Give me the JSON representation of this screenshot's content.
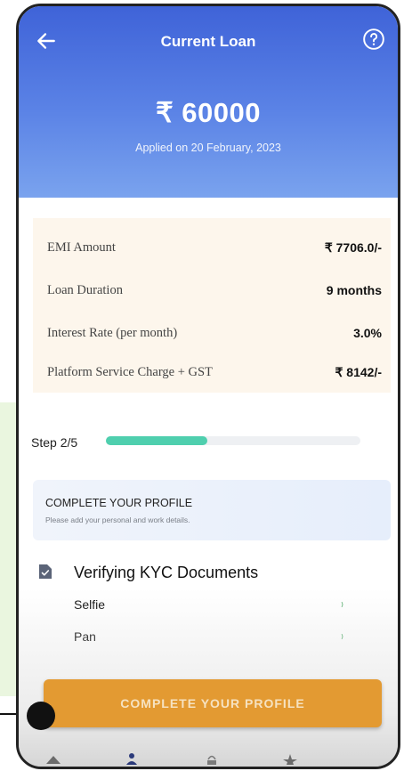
{
  "header": {
    "title": "Current Loan",
    "amount": "₹ 60000",
    "applied_on": "Applied on 20 February, 2023"
  },
  "details": [
    {
      "label": "EMI Amount",
      "value": "₹ 7706.0/-"
    },
    {
      "label": "Loan Duration",
      "value": "9 months"
    },
    {
      "label": "Interest Rate (per month)",
      "value": "3.0%"
    },
    {
      "label": "Platform Service Charge + GST",
      "value": "₹ 8142/-"
    }
  ],
  "progress": {
    "label": "Step 2/5",
    "fraction": 0.4
  },
  "profile_card": {
    "title": "COMPLETE YOUR PROFILE",
    "subtitle": "Please add your personal and work details."
  },
  "kyc": {
    "title": "Verifying KYC Documents",
    "items": [
      {
        "label": "Selfie",
        "status": "⁾"
      },
      {
        "label": "Pan",
        "status": "⁾"
      }
    ]
  },
  "cta": {
    "label": "COMPLETE YOUR PROFILE"
  },
  "colors": {
    "header_top": "#3f63d8",
    "header_bottom": "#7aa3ee",
    "progress_fill": "#4fcfae",
    "cta": "#e39a32",
    "details_bg": "#fdf6ec"
  },
  "icons": {
    "back": "back-arrow-icon",
    "help": "help-circle-icon",
    "kyc": "document-check-icon"
  }
}
